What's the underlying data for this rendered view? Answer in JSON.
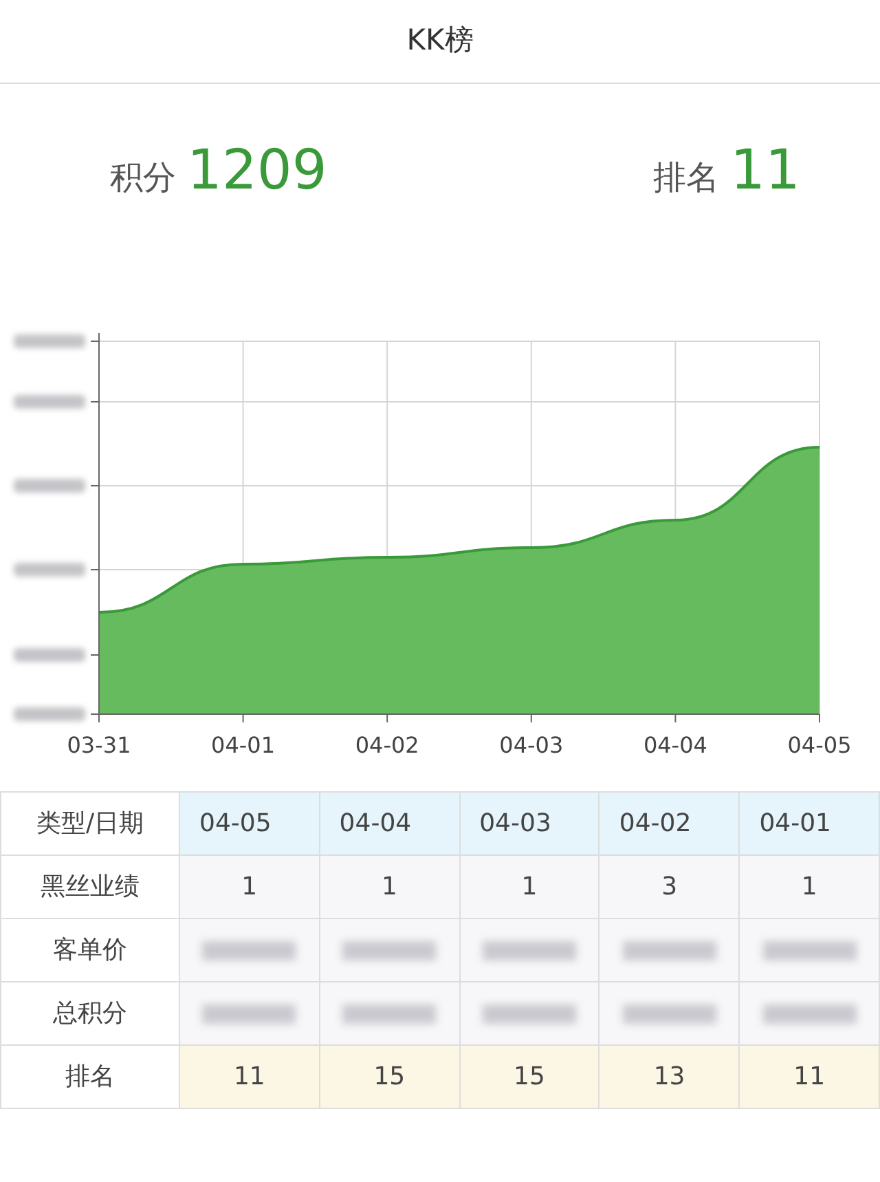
{
  "header": {
    "title": "KK榜"
  },
  "summary": [
    {
      "label": "积分",
      "value": "1209"
    },
    {
      "label": "排名",
      "value": "11"
    }
  ],
  "chart": {
    "x_labels": [
      "03-31",
      "04-01",
      "04-02",
      "04-03",
      "04-04",
      "04-05"
    ]
  },
  "table": {
    "rows": [
      {
        "kind": "header",
        "label": "类型/日期",
        "cells": [
          "04-05",
          "04-04",
          "04-03",
          "04-02",
          "04-01"
        ]
      },
      {
        "kind": "text",
        "label": "黑丝业绩",
        "cells": [
          "1",
          "1",
          "1",
          "3",
          "1"
        ]
      },
      {
        "kind": "blurred",
        "label": "客单价"
      },
      {
        "kind": "blurred",
        "label": "总积分"
      },
      {
        "kind": "highlight",
        "label": "排名",
        "cells": [
          "11",
          "15",
          "15",
          "13",
          "11"
        ]
      }
    ]
  }
}
